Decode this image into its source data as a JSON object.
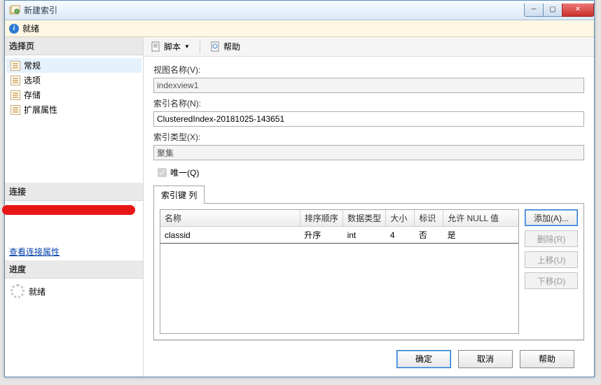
{
  "window": {
    "title": "新建索引"
  },
  "status": {
    "text": "就绪"
  },
  "leftpanel": {
    "select_hdr": "选择页",
    "conn_hdr": "连接",
    "progress_hdr": "进度",
    "progress_text": "就绪",
    "link": "查看连接属性",
    "pages": [
      "常规",
      "选项",
      "存储",
      "扩展属性"
    ]
  },
  "toolbar": {
    "script": "脚本",
    "help": "帮助"
  },
  "form": {
    "view_label": "视图名称(V):",
    "view_value": "indexview1",
    "idxname_label": "索引名称(N):",
    "idxname_value": "ClusteredIndex-20181025-143651",
    "idxtype_label": "索引类型(X):",
    "idxtype_value": "聚集",
    "unique_label": "唯一(Q)"
  },
  "tabs": {
    "keycols": "索引键 列"
  },
  "table": {
    "headers": {
      "name": "名称",
      "sort": "排序顺序",
      "dtype": "数据类型",
      "size": "大小",
      "ident": "标识",
      "nullable": "允许 NULL 值"
    },
    "rows": [
      {
        "name": "classid",
        "sort": "升序",
        "dtype": "int",
        "size": "4",
        "ident": "否",
        "nullable": "是"
      }
    ]
  },
  "buttons": {
    "add": "添加(A)...",
    "remove": "删除(R)",
    "up": "上移(U)",
    "down": "下移(D)"
  },
  "footer": {
    "ok": "确定",
    "cancel": "取消",
    "help": "帮助"
  }
}
